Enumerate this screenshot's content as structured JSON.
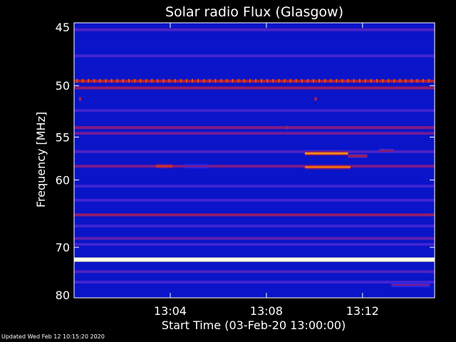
{
  "footer_text": "Updated Wed Feb 12 10:15:20 2020",
  "colors": {
    "background": "#000000",
    "text": "#ffffff",
    "colormap": [
      "#00004a",
      "#0000a8",
      "#1a2cff",
      "#7a1a8c",
      "#c82020",
      "#ff8a00",
      "#ffffc8"
    ]
  },
  "chart_data": {
    "type": "heatmap",
    "title": "Solar radio Flux (Glasgow)",
    "xlabel": "Start Time (03-Feb-20 13:00:00)",
    "ylabel": "Frequency [MHz]",
    "x_unit": "minutes after 13:00:00",
    "xlim": [
      0,
      15
    ],
    "ylim": [
      45,
      80
    ],
    "y_scale": "reciprocal",
    "y_inverted": true,
    "x_ticks": [
      {
        "value": 4,
        "label": "13:04"
      },
      {
        "value": 8,
        "label": "13:08"
      },
      {
        "value": 12,
        "label": "13:12"
      }
    ],
    "y_ticks": [
      {
        "value": 45,
        "label": "45"
      },
      {
        "value": 50,
        "label": "50"
      },
      {
        "value": 55,
        "label": "55"
      },
      {
        "value": 60,
        "label": "60"
      },
      {
        "value": 70,
        "label": "70"
      },
      {
        "value": 80,
        "label": "80"
      }
    ],
    "intensity_scale": "0 = background, 1 = brightest",
    "background_intensity": 0.3,
    "horizontal_features": [
      {
        "freq": 45.5,
        "intensity": 0.42
      },
      {
        "freq": 47.5,
        "intensity": 0.4
      },
      {
        "freq": 49.6,
        "intensity": 0.62
      },
      {
        "freq": 50.2,
        "intensity": 0.55
      },
      {
        "freq": 52.3,
        "intensity": 0.4
      },
      {
        "freq": 54.0,
        "intensity": 0.52
      },
      {
        "freq": 54.6,
        "intensity": 0.48
      },
      {
        "freq": 56.6,
        "intensity": 0.42
      },
      {
        "freq": 58.3,
        "intensity": 0.5
      },
      {
        "freq": 60.8,
        "intensity": 0.4
      },
      {
        "freq": 62.7,
        "intensity": 0.4
      },
      {
        "freq": 64.8,
        "intensity": 0.55
      },
      {
        "freq": 66.5,
        "intensity": 0.4
      },
      {
        "freq": 68.5,
        "intensity": 0.45
      },
      {
        "freq": 69.5,
        "intensity": 0.4
      },
      {
        "freq": 72.2,
        "intensity": 1.0
      },
      {
        "freq": 74.5,
        "intensity": 0.42
      },
      {
        "freq": 76.6,
        "intensity": 0.4
      }
    ],
    "events": [
      {
        "t_start": 9.6,
        "t_end": 11.4,
        "freq": 56.8,
        "intensity": 0.85
      },
      {
        "t_start": 9.6,
        "t_end": 11.5,
        "freq": 58.4,
        "intensity": 0.8
      },
      {
        "t_start": 11.4,
        "t_end": 12.2,
        "freq": 57.1,
        "intensity": 0.6
      },
      {
        "t_start": 3.4,
        "t_end": 4.1,
        "freq": 58.3,
        "intensity": 0.7
      },
      {
        "t_start": 4.6,
        "t_end": 5.6,
        "freq": 58.3,
        "intensity": 0.5
      },
      {
        "t_start": 12.7,
        "t_end": 13.3,
        "freq": 56.5,
        "intensity": 0.55
      },
      {
        "t_start": 13.2,
        "t_end": 14.8,
        "freq": 77.2,
        "intensity": 0.5
      },
      {
        "t_start": 0.2,
        "t_end": 0.3,
        "freq": 51.2,
        "intensity": 0.65
      },
      {
        "t_start": 10.0,
        "t_end": 10.1,
        "freq": 51.2,
        "intensity": 0.65
      },
      {
        "t_start": 8.8,
        "t_end": 8.9,
        "freq": 54.0,
        "intensity": 0.6
      }
    ],
    "periodic_spikes": {
      "freq": 49.6,
      "period_minutes": 0.24,
      "intensity": 0.75
    },
    "grid": false,
    "legend": "none"
  }
}
